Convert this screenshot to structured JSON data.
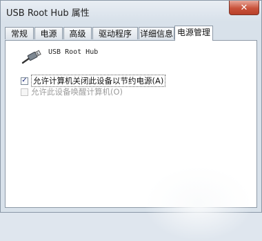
{
  "window": {
    "title": "USB Root Hub 属性"
  },
  "tabs": [
    {
      "label": "常规"
    },
    {
      "label": "电源"
    },
    {
      "label": "高级"
    },
    {
      "label": "驱动程序"
    },
    {
      "label": "详细信息"
    },
    {
      "label": "电源管理",
      "active": true
    }
  ],
  "device": {
    "name": "USB Root Hub",
    "icon": "usb-plug-icon"
  },
  "options": [
    {
      "label": "允许计算机关闭此设备以节约电源(A)",
      "checked": true,
      "enabled": true
    },
    {
      "label": "允许此设备唤醒计算机(O)",
      "checked": false,
      "enabled": false
    }
  ],
  "colors": {
    "close_button": "#c9523b",
    "checkmark": "#1d2c7e",
    "disabled_text": "#9c9c9c"
  }
}
